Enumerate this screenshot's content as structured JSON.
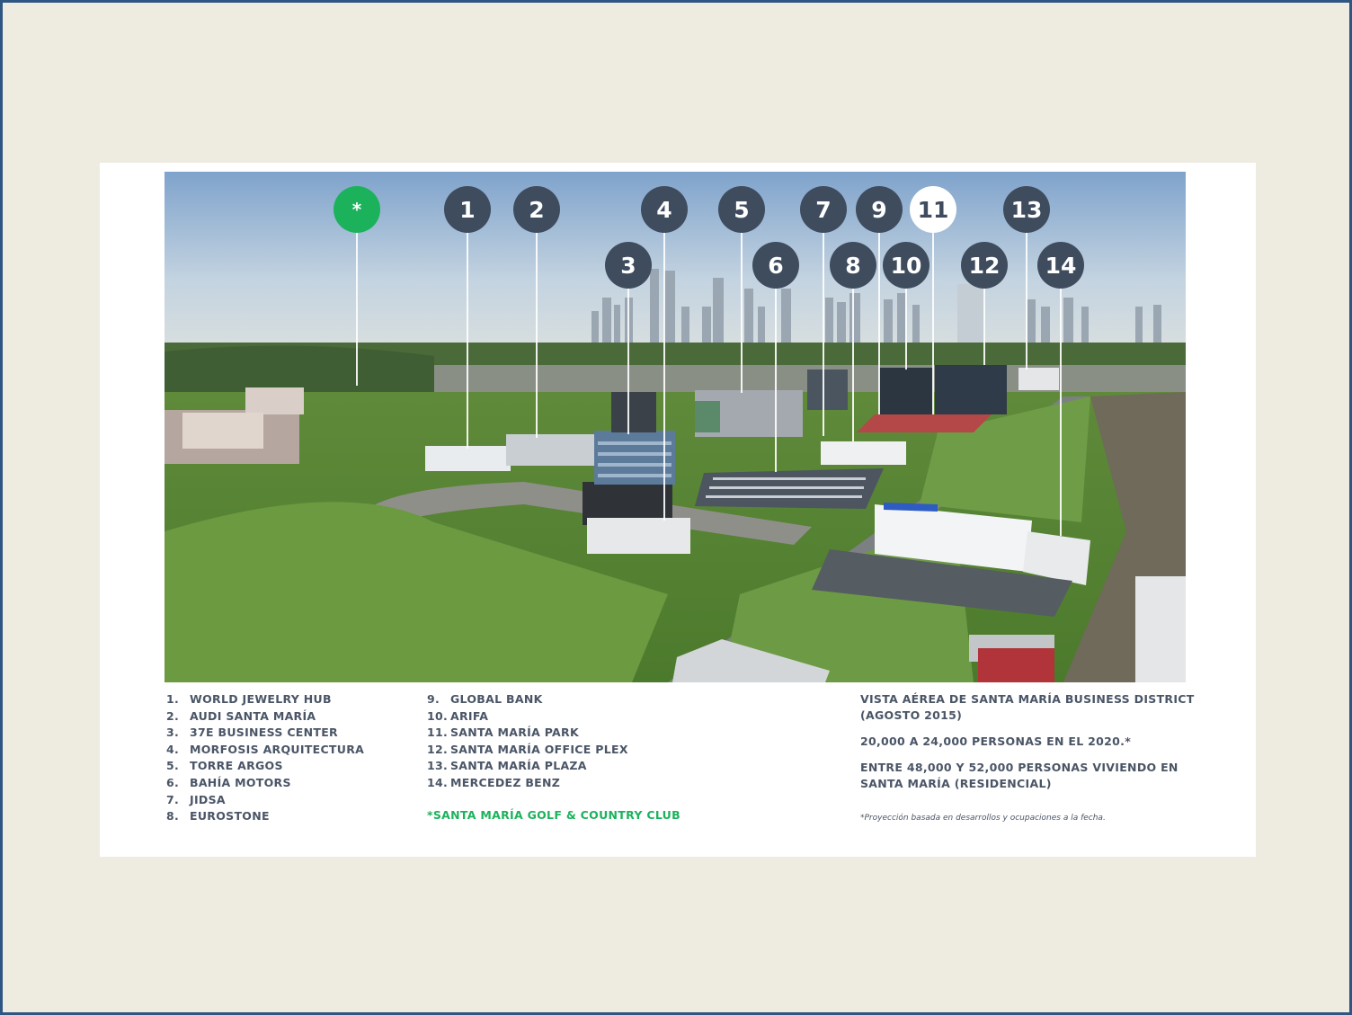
{
  "markers": {
    "golf": "*",
    "m1": "1",
    "m2": "2",
    "m3": "3",
    "m4": "4",
    "m5": "5",
    "m6": "6",
    "m7": "7",
    "m8": "8",
    "m9": "9",
    "m10": "10",
    "m11": "11",
    "m12": "12",
    "m13": "13",
    "m14": "14"
  },
  "legend_left": [
    {
      "num": "1.",
      "label": "WORLD JEWELRY HUB"
    },
    {
      "num": "2.",
      "label": "AUDI SANTA MARÍA"
    },
    {
      "num": "3.",
      "label": "37E BUSINESS CENTER"
    },
    {
      "num": "4.",
      "label": "MORFOSIS ARQUITECTURA"
    },
    {
      "num": "5.",
      "label": "TORRE ARGOS"
    },
    {
      "num": "6.",
      "label": "BAHÍA MOTORS"
    },
    {
      "num": "7.",
      "label": "JIDSA"
    },
    {
      "num": "8.",
      "label": "EUROSTONE"
    }
  ],
  "legend_right": [
    {
      "num": "9.",
      "label": "GLOBAL BANK"
    },
    {
      "num": "10.",
      "label": "ARIFA"
    },
    {
      "num": "11.",
      "label": "SANTA MARÍA PARK"
    },
    {
      "num": "12.",
      "label": "SANTA MARÍA OFFICE PLEX"
    },
    {
      "num": "13.",
      "label": "SANTA MARÍA PLAZA"
    },
    {
      "num": "14.",
      "label": "MERCEDEZ BENZ"
    }
  ],
  "golf_label": "*SANTA MARÍA GOLF & COUNTRY CLUB",
  "info": {
    "title": "VISTA AÉREA DE SANTA MARÍA BUSINESS DISTRICT (AGOSTO 2015)",
    "line1": "20,000 A 24,000 PERSONAS EN EL 2020.*",
    "line2": "ENTRE 48,000 Y 52,000 PERSONAS VIVIENDO EN SANTA MARÍA (RESIDENCIAL)",
    "footnote": "*Proyección basada en desarrollos y ocupaciones a la fecha."
  },
  "colors": {
    "marker": "#3f4c5e",
    "accent_green": "#1cb25c",
    "text": "#4a5566",
    "frame_border": "#2f5583",
    "frame_bg": "#eeebe1"
  }
}
